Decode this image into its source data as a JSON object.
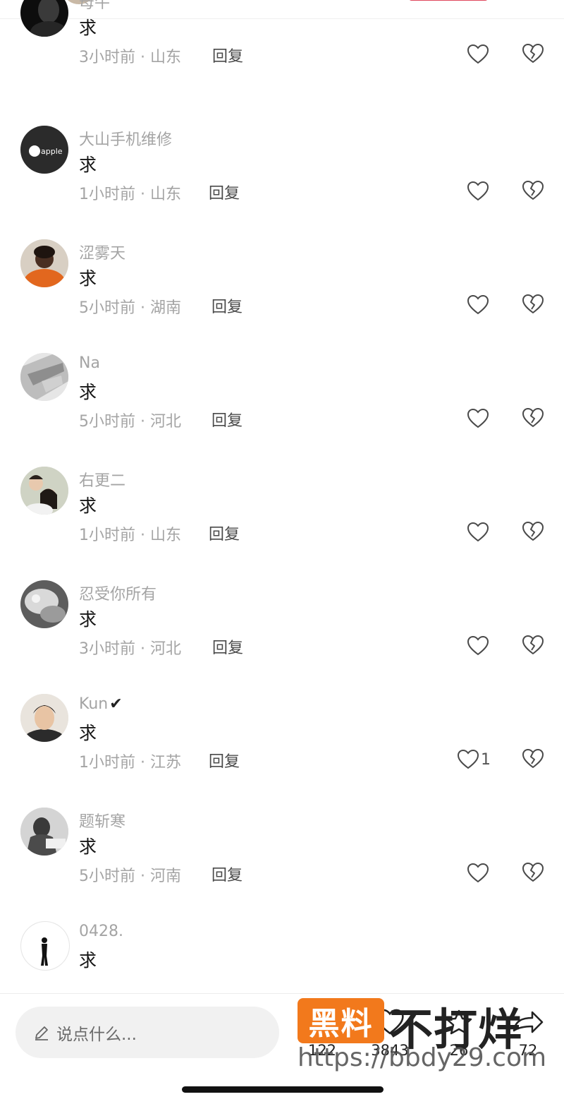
{
  "comments": [
    {
      "name": "母牛",
      "text": "求",
      "time": "3小时前",
      "location": "山东",
      "reply": "回复",
      "likes": "",
      "avatar": "dark-silhouette-avatar"
    },
    {
      "name": "大山手机维修",
      "text": "求",
      "time": "1小时前",
      "location": "山东",
      "reply": "回复",
      "likes": "",
      "avatar": "apple-logo-avatar"
    },
    {
      "name": "涩雾天",
      "text": "求",
      "time": "5小时前",
      "location": "湖南",
      "reply": "回复",
      "likes": "",
      "avatar": "person-orange-shirt-avatar"
    },
    {
      "name": "Na",
      "text": "求",
      "time": "5小时前",
      "location": "河北",
      "reply": "回复",
      "likes": "",
      "avatar": "gray-fabric-avatar"
    },
    {
      "name": "右更二",
      "text": "求",
      "time": "1小时前",
      "location": "山东",
      "reply": "回复",
      "likes": "",
      "avatar": "couple-photo-avatar"
    },
    {
      "name": "忍受你所有",
      "text": "求",
      "time": "3小时前",
      "location": "河北",
      "reply": "回复",
      "likes": "",
      "avatar": "blurred-photo-avatar"
    },
    {
      "name": "Kun",
      "text": "求",
      "time": "1小时前",
      "location": "江苏",
      "reply": "回复",
      "likes": "1",
      "avatar": "young-man-avatar",
      "verified": "✔"
    },
    {
      "name": "题斩寒",
      "text": "求",
      "time": "5小时前",
      "location": "河南",
      "reply": "回复",
      "likes": "",
      "avatar": "bw-person-avatar"
    },
    {
      "name": "0428.",
      "text": "求",
      "time": "",
      "location": "",
      "reply": "",
      "likes": "",
      "avatar": "standing-figure-avatar"
    }
  ],
  "bottom": {
    "input_placeholder": "说点什么...",
    "actions": [
      {
        "name": "comment",
        "icon": "comment-icon",
        "count": "122"
      },
      {
        "name": "like",
        "icon": "heart-icon",
        "count": "3843"
      },
      {
        "name": "collect",
        "icon": "star-icon",
        "count": "26"
      },
      {
        "name": "share",
        "icon": "share-arrow-icon",
        "count": "72"
      }
    ]
  },
  "watermark": {
    "badge": "黑料",
    "title": "不打烊",
    "url": "https://bbdy29.com"
  },
  "colors": {
    "secondary_text": "#a4a4a4",
    "primary_text": "#161616",
    "input_bg": "#f1f1f1",
    "watermark_orange": "#f2791c"
  }
}
